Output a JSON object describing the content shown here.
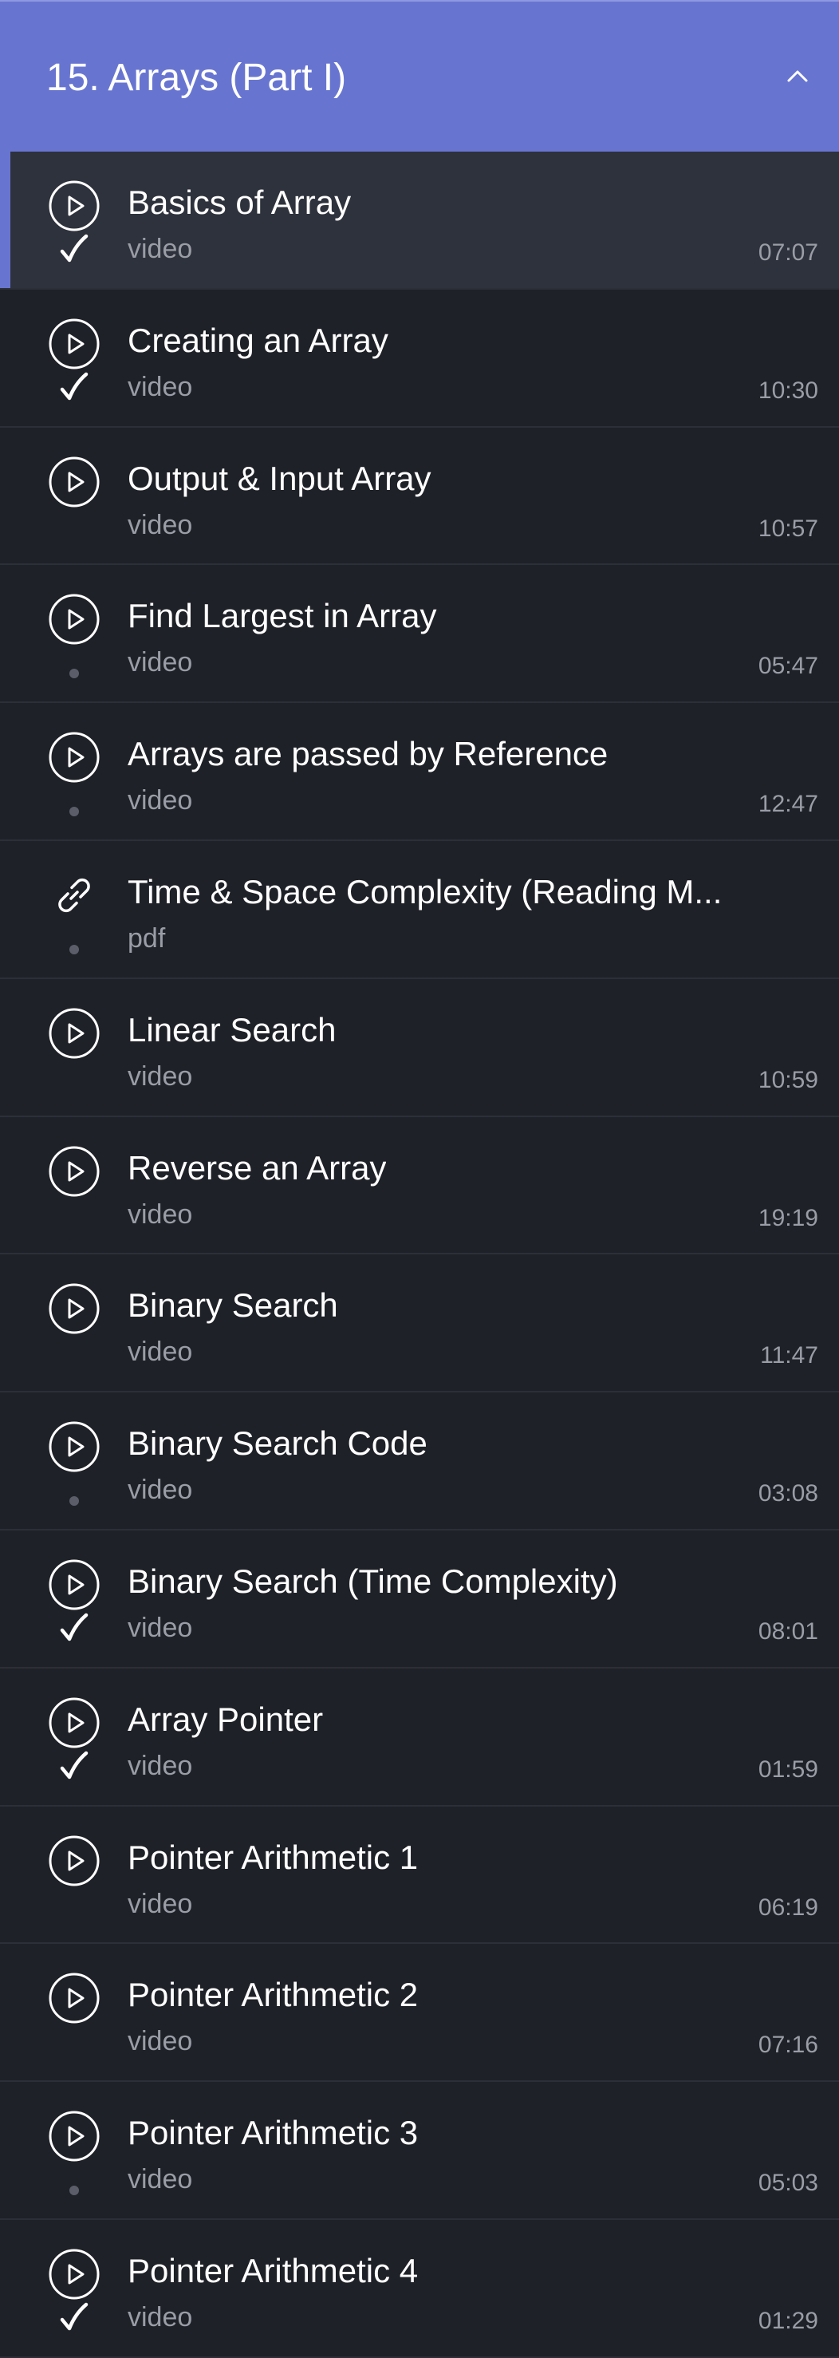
{
  "section": {
    "title": "15. Arrays (Part I)",
    "toggle_icon": "chevron-up-icon"
  },
  "colors": {
    "header_bg": "#6875d0",
    "list_bg": "#1f2128",
    "active_bg": "#2e323c",
    "accent": "#6875d0",
    "muted_text": "#9a9da6",
    "incomplete_dot": "#5b5e68"
  },
  "items": [
    {
      "title": "Basics of Array",
      "type": "video",
      "duration": "07:07",
      "icon": "play-circle-icon",
      "status": "completed",
      "active": true
    },
    {
      "title": "Creating an Array",
      "type": "video",
      "duration": "10:30",
      "icon": "play-circle-icon",
      "status": "completed",
      "active": false
    },
    {
      "title": "Output & Input Array",
      "type": "video",
      "duration": "10:57",
      "icon": "play-circle-icon",
      "status": "none",
      "active": false
    },
    {
      "title": "Find Largest in Array",
      "type": "video",
      "duration": "05:47",
      "icon": "play-circle-icon",
      "status": "incomplete",
      "active": false
    },
    {
      "title": "Arrays are passed by Reference",
      "type": "video",
      "duration": "12:47",
      "icon": "play-circle-icon",
      "status": "incomplete",
      "active": false
    },
    {
      "title": "Time & Space Complexity (Reading M...",
      "type": "pdf",
      "duration": "",
      "icon": "link-icon",
      "status": "incomplete",
      "active": false
    },
    {
      "title": "Linear Search",
      "type": "video",
      "duration": "10:59",
      "icon": "play-circle-icon",
      "status": "none",
      "active": false
    },
    {
      "title": "Reverse an Array",
      "type": "video",
      "duration": "19:19",
      "icon": "play-circle-icon",
      "status": "none",
      "active": false
    },
    {
      "title": "Binary Search",
      "type": "video",
      "duration": "11:47",
      "icon": "play-circle-icon",
      "status": "none",
      "active": false
    },
    {
      "title": "Binary Search Code",
      "type": "video",
      "duration": "03:08",
      "icon": "play-circle-icon",
      "status": "incomplete",
      "active": false
    },
    {
      "title": "Binary Search (Time Complexity)",
      "type": "video",
      "duration": "08:01",
      "icon": "play-circle-icon",
      "status": "completed",
      "active": false
    },
    {
      "title": "Array Pointer",
      "type": "video",
      "duration": "01:59",
      "icon": "play-circle-icon",
      "status": "completed",
      "active": false
    },
    {
      "title": "Pointer Arithmetic 1",
      "type": "video",
      "duration": "06:19",
      "icon": "play-circle-icon",
      "status": "none",
      "active": false
    },
    {
      "title": "Pointer Arithmetic 2",
      "type": "video",
      "duration": "07:16",
      "icon": "play-circle-icon",
      "status": "none",
      "active": false
    },
    {
      "title": "Pointer Arithmetic 3",
      "type": "video",
      "duration": "05:03",
      "icon": "play-circle-icon",
      "status": "incomplete",
      "active": false
    },
    {
      "title": "Pointer Arithmetic 4",
      "type": "video",
      "duration": "01:29",
      "icon": "play-circle-icon",
      "status": "completed",
      "active": false
    }
  ]
}
